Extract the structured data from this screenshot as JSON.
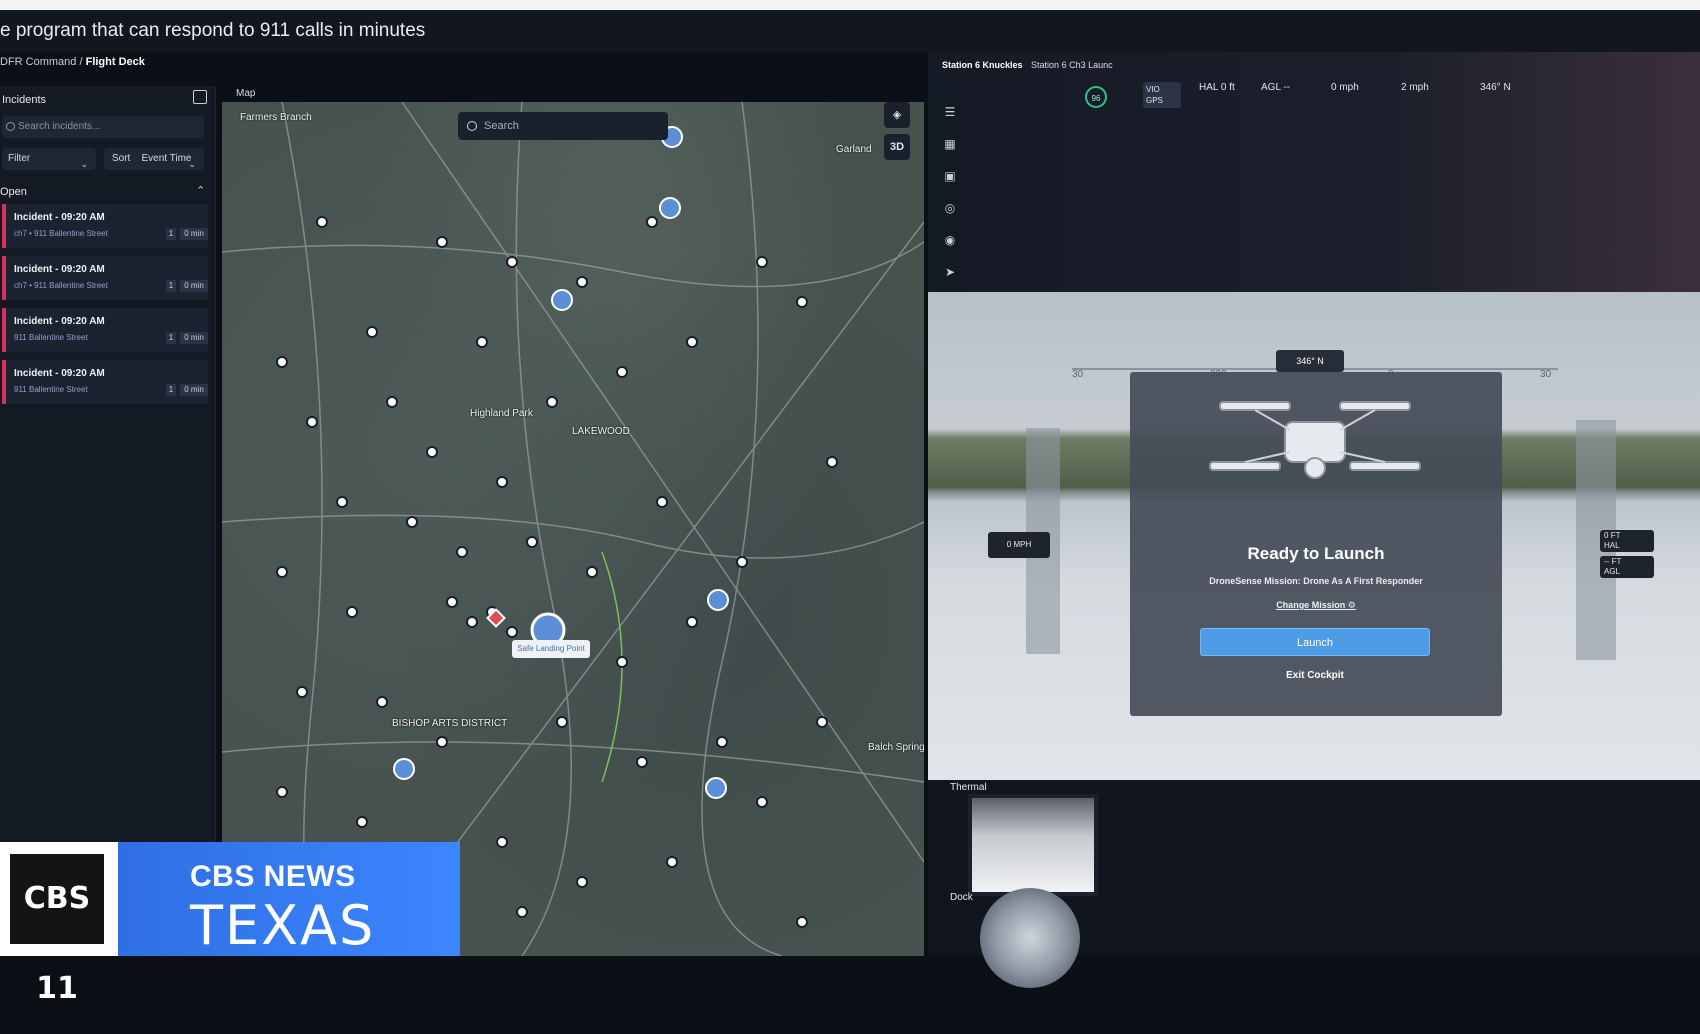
{
  "headline": "e program that can respond to 911 calls in minutes",
  "breadcrumb": {
    "parent": "DFR Command",
    "separator": "/",
    "current": "Flight Deck"
  },
  "incidents_panel": {
    "title": "Incidents",
    "search_placeholder": "Search incidents...",
    "filter_label": "Filter",
    "sort_label": "Sort",
    "sort_value": "Event Time",
    "open_section": "Open",
    "items": [
      {
        "title": "Incident - 09:20 AM",
        "subtitle": "ch7 • 911 Ballentine Street",
        "count": "1",
        "time": "0 min"
      },
      {
        "title": "Incident - 09:20 AM",
        "subtitle": "ch7 • 911 Ballentine Street",
        "count": "1",
        "time": "0 min"
      },
      {
        "title": "Incident - 09:20 AM",
        "subtitle": "911 Ballentine Street",
        "count": "1",
        "time": "0 min"
      },
      {
        "title": "Incident - 09:20 AM",
        "subtitle": "911 Ballentine Street",
        "count": "1",
        "time": "0 min"
      }
    ]
  },
  "map": {
    "label": "Map",
    "search_placeholder": "Search",
    "controls": [
      "layers",
      "3D"
    ],
    "places": [
      "Farmers Branch",
      "Garland",
      "Highland Park",
      "LAKEWOOD",
      "BISHOP ARTS DISTRICT",
      "Balch Springs"
    ],
    "safe_landing_label": "Safe Landing Point"
  },
  "drone": {
    "station_tabs": [
      "Station 6 Knuckles",
      "Station 6 Ch3 Launc"
    ],
    "battery_badge": "96",
    "vio": "VIO",
    "gps": "GPS",
    "telemetry": {
      "hal": "HAL 0 ft",
      "agl": "AGL --",
      "speed": "0 mph",
      "wind": "2 mph",
      "heading": "346° N"
    },
    "heading_box": "346° N",
    "tape_numbers": [
      "30",
      "330",
      "0",
      "30"
    ],
    "mph_box": "0  MPH",
    "hal_box": {
      "value": "0",
      "unit_top": "FT",
      "unit_bottom": "HAL"
    },
    "agl_box": {
      "value": "--",
      "unit_top": "FT",
      "unit_bottom": "AGL"
    },
    "ready_title": "Ready to Launch",
    "mission_text": "DroneSense Mission: Drone As A First Responder",
    "change_mission": "Change Mission",
    "launch_button": "Launch",
    "exit_button": "Exit Cockpit",
    "thermal_label": "Thermal",
    "dock_label": "Dock"
  },
  "broadcast": {
    "channel_logo": "CBS 11",
    "network": "CBS NEWS",
    "region": "TEXAS"
  },
  "colors": {
    "incident_accent": "#d8325a",
    "launch_button": "#4d9ce8",
    "cbs_blue": "#3c86ff",
    "battery_ok": "#2ec27e"
  }
}
